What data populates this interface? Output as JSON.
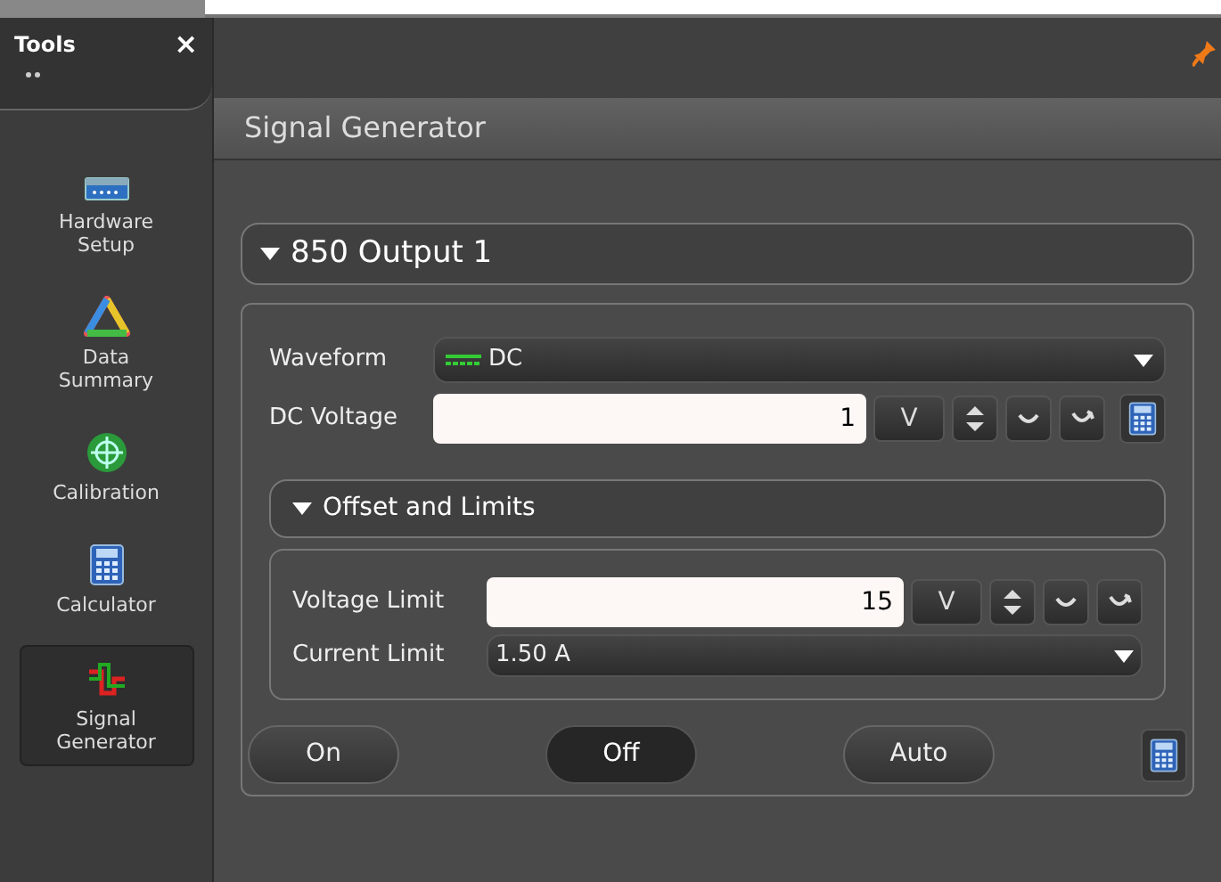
{
  "sidebar": {
    "title": "Tools",
    "close": "×",
    "items": [
      {
        "kind": "hardware",
        "label": "Hardware Setup",
        "selected": false
      },
      {
        "kind": "summary",
        "label": "Data Summary",
        "selected": false
      },
      {
        "kind": "calibration",
        "label": "Calibration",
        "selected": false
      },
      {
        "kind": "calculator",
        "label": "Calculator",
        "selected": false
      },
      {
        "kind": "signal",
        "label": "Signal Generator",
        "selected": true
      }
    ]
  },
  "panel": {
    "title": "Signal Generator"
  },
  "output": {
    "title": "850 Output 1",
    "expanded": true,
    "waveform": {
      "label": "Waveform",
      "value": "DC"
    },
    "dc_voltage": {
      "label": "DC Voltage",
      "value": "1",
      "unit": "V"
    },
    "offset": {
      "title": "Offset and Limits",
      "expanded": true,
      "voltage_limit": {
        "label": "Voltage Limit",
        "value": "15",
        "unit": "V"
      },
      "current_limit": {
        "label": "Current Limit",
        "value": "1.50 A"
      }
    },
    "modes": [
      {
        "label": "On",
        "selected": false
      },
      {
        "label": "Off",
        "selected": true
      },
      {
        "label": "Auto",
        "selected": false
      }
    ]
  }
}
